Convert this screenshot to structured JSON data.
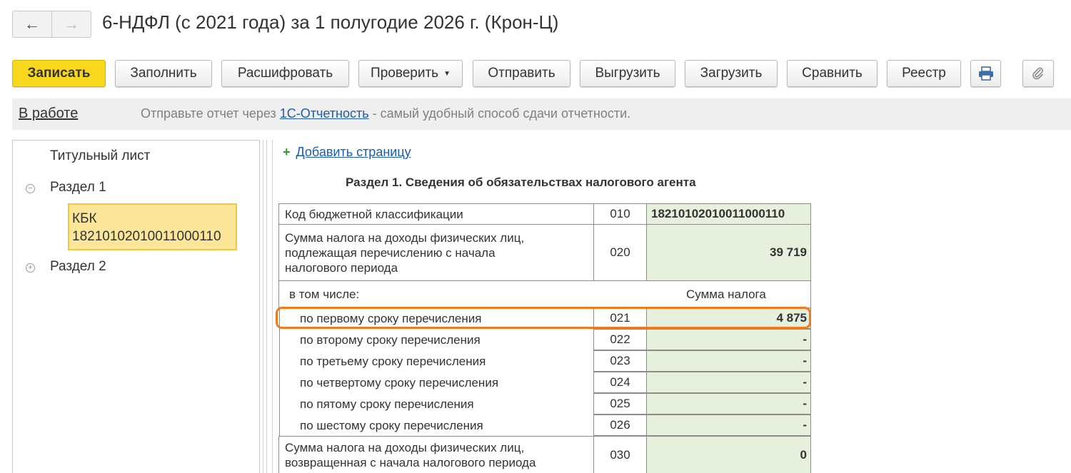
{
  "window": {
    "title": "6-НДФЛ (с 2021 года) за 1 полугодие 2026 г. (Крон-Ц)",
    "nav_back_icon": "arrow-left-icon",
    "nav_forward_icon": "arrow-right-icon"
  },
  "toolbar": {
    "save": "Записать",
    "fill": "Заполнить",
    "decode": "Расшифровать",
    "check": "Проверить",
    "send": "Отправить",
    "export": "Выгрузить",
    "import": "Загрузить",
    "compare": "Сравнить",
    "registry": "Реестр",
    "print_icon": "printer-icon",
    "attach_icon": "paperclip-icon"
  },
  "status": {
    "state": "В работе",
    "message_before": "Отправьте отчет через ",
    "message_link": "1С-Отчетность",
    "message_after": " - самый удобный способ сдачи отчетности."
  },
  "tree": {
    "items": [
      {
        "label": "Титульный лист"
      },
      {
        "label": "Раздел 1",
        "toggle": "⊖"
      },
      {
        "label": "Раздел 2",
        "toggle": "⊕"
      }
    ],
    "selected": {
      "line1": "КБК",
      "line2": "18210102010011000110"
    }
  },
  "content": {
    "add_page": "Добавить страницу",
    "section_title": "Раздел 1. Сведения об обязательствах налогового агента",
    "kbk_row": {
      "label": "Код бюджетной классификации",
      "code": "010",
      "value": "18210102010011000110"
    },
    "sum_row": {
      "label": "Сумма налога на доходы физических лиц, подлежащая перечислению с начала налогового периода",
      "code": "020",
      "value": "39 719"
    },
    "incl_label": "в том числе:",
    "incl_header": "Сумма налога",
    "terms": [
      {
        "label": "по первому сроку перечисления",
        "code": "021",
        "value": "4 875"
      },
      {
        "label": "по второму сроку перечисления",
        "code": "022",
        "value": "-"
      },
      {
        "label": "по третьему сроку перечисления",
        "code": "023",
        "value": "-"
      },
      {
        "label": "по четвертому сроку перечисления",
        "code": "024",
        "value": "-"
      },
      {
        "label": "по пятому сроку перечисления",
        "code": "025",
        "value": "-"
      },
      {
        "label": "по шестому сроку перечисления",
        "code": "026",
        "value": "-"
      }
    ],
    "returned_row": {
      "label": "Сумма налога на доходы физических лиц, возвращенная с начала налогового периода",
      "code": "030",
      "value": "0"
    }
  },
  "colors": {
    "primary_button": "#f7d81c",
    "highlight": "#f07a1e",
    "input_fill": "#e6f0dc",
    "tree_selected": "#fbe69a",
    "link": "#1c5ca8"
  }
}
